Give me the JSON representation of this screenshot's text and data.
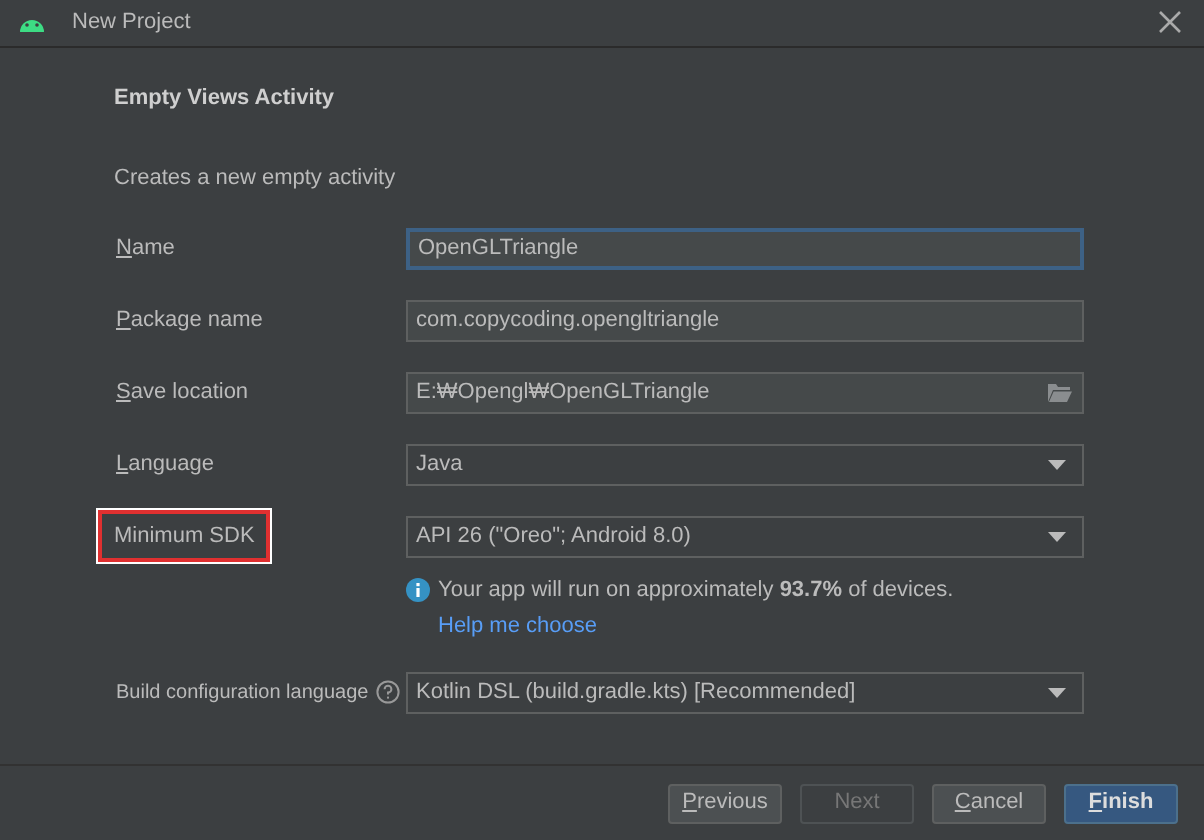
{
  "window": {
    "title": "New Project"
  },
  "heading": "Empty Views Activity",
  "description": "Creates a new empty activity",
  "fields": [
    {
      "label": "Name",
      "mnemonic": true,
      "kind": "text",
      "value": "OpenGLTriangle",
      "focused": true,
      "highlighted": false
    },
    {
      "label": "Package name",
      "mnemonic": true,
      "kind": "text",
      "value": "com.copycoding.opengltriangle",
      "focused": false,
      "highlighted": false
    },
    {
      "label": "Save location",
      "mnemonic": true,
      "kind": "folder",
      "value": "E:₩Opengl₩OpenGLTriangle",
      "focused": false,
      "highlighted": false
    },
    {
      "label": "Language",
      "mnemonic": true,
      "kind": "dropdown",
      "value": "Java",
      "focused": false,
      "highlighted": false
    },
    {
      "label": "Minimum SDK",
      "mnemonic": false,
      "kind": "dropdown",
      "value": "API 26 (\"Oreo\"; Android 8.0)",
      "focused": false,
      "highlighted": true
    }
  ],
  "info": {
    "text": "Your app will run on approximately **93.7%** of devices.",
    "link": "Help me choose"
  },
  "build_config": {
    "label": "Build configuration language",
    "value": "Kotlin DSL (build.gradle.kts) [Recommended]"
  },
  "buttons": [
    {
      "label": "Previous",
      "mnemonic": true,
      "disabled": false,
      "primary": false
    },
    {
      "label": "Next",
      "mnemonic": false,
      "disabled": true,
      "primary": false
    },
    {
      "label": "Cancel",
      "mnemonic": true,
      "disabled": false,
      "primary": false
    },
    {
      "label": "Finish",
      "mnemonic": true,
      "disabled": false,
      "primary": true
    }
  ]
}
